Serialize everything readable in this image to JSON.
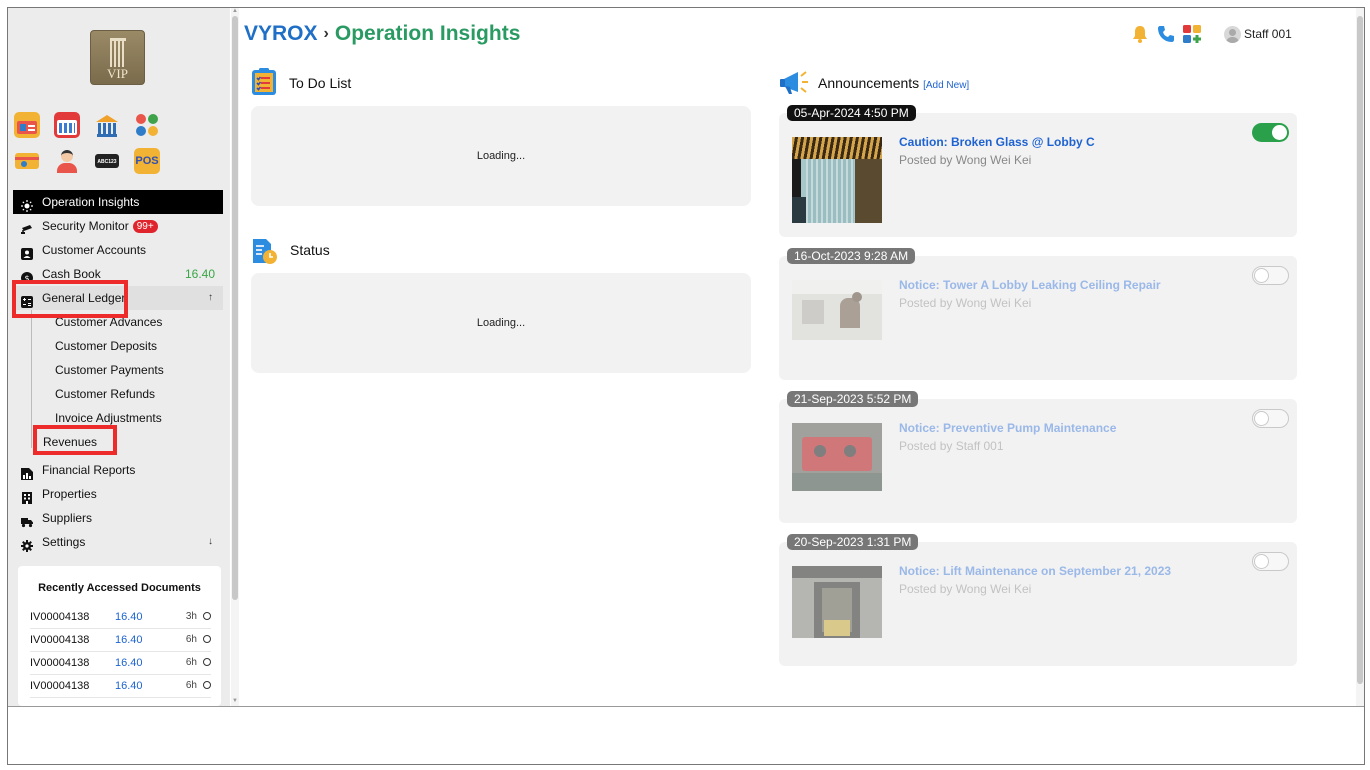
{
  "header": {
    "brand": "VYROX",
    "separator": "›",
    "page": "Operation Insights",
    "user": "Staff 001"
  },
  "logo": {
    "text": "VIP"
  },
  "apps": [
    {
      "name": "id-card-app-icon"
    },
    {
      "name": "calendar-app-icon"
    },
    {
      "name": "bank-app-icon"
    },
    {
      "name": "community-app-icon"
    },
    {
      "name": "keycard-app-icon"
    },
    {
      "name": "receptionist-app-icon"
    },
    {
      "name": "plate-recognition-app-icon",
      "label": "ABC123"
    },
    {
      "name": "pos-app-icon",
      "label": "POS"
    }
  ],
  "nav": {
    "operation_insights": "Operation Insights",
    "security_monitor": "Security Monitor",
    "security_badge": "99+",
    "customer_accounts": "Customer Accounts",
    "cash_book": "Cash Book",
    "cash_book_amount": "16.40",
    "general_ledger": "General Ledger",
    "general_ledger_arrow": "↑",
    "sub": [
      "Customer Advances",
      "Customer Deposits",
      "Customer Payments",
      "Customer Refunds",
      "Invoice Adjustments",
      "Revenues"
    ],
    "financial_reports": "Financial Reports",
    "properties": "Properties",
    "suppliers": "Suppliers",
    "settings": "Settings",
    "settings_arrow": "↓"
  },
  "recent": {
    "title": "Recently Accessed Documents",
    "rows": [
      {
        "id": "IV00004138",
        "amount": "16.40",
        "time": "3h"
      },
      {
        "id": "IV00004138",
        "amount": "16.40",
        "time": "6h"
      },
      {
        "id": "IV00004138",
        "amount": "16.40",
        "time": "6h"
      },
      {
        "id": "IV00004138",
        "amount": "16.40",
        "time": "6h"
      }
    ]
  },
  "todo": {
    "title": "To Do List",
    "loading": "Loading..."
  },
  "status": {
    "title": "Status",
    "loading": "Loading..."
  },
  "announcements": {
    "title": "Announcements",
    "add_new": "[Add New]",
    "items": [
      {
        "date": "05-Apr-2024 4:50 PM",
        "title": "Caution: Broken Glass @ Lobby C",
        "by": "Posted by Wong Wei Kei",
        "active": true
      },
      {
        "date": "16-Oct-2023 9:28 AM",
        "title": "Notice: Tower A Lobby Leaking Ceiling Repair",
        "by": "Posted by Wong Wei Kei",
        "active": false
      },
      {
        "date": "21-Sep-2023 5:52 PM",
        "title": "Notice: Preventive Pump Maintenance",
        "by": "Posted by Staff 001",
        "active": false
      },
      {
        "date": "20-Sep-2023 1:31 PM",
        "title": "Notice: Lift Maintenance on September 21, 2023",
        "by": "Posted by Wong Wei Kei",
        "active": false
      }
    ]
  },
  "colors": {
    "brand_blue": "#1f6fc7",
    "page_green": "#2a9a63",
    "highlight_red": "#ee2b2b",
    "toggle_on": "#2aa04a"
  }
}
